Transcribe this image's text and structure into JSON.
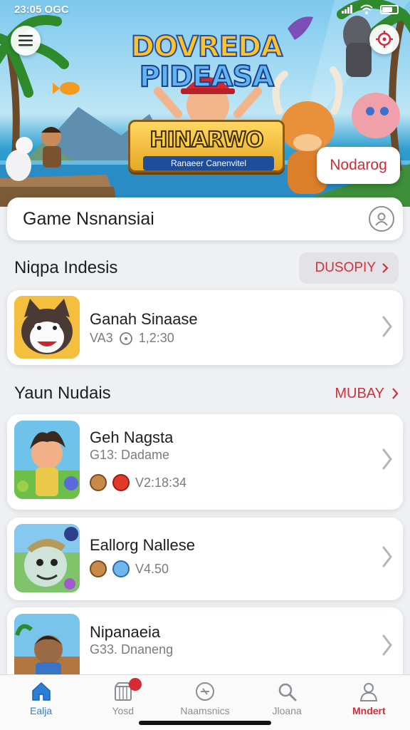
{
  "status_bar": {
    "time": "23:05 OGC"
  },
  "hero": {
    "title_line1": "DOVREDA",
    "title_line2": "PIDEASA",
    "banner_title": "HINARWO",
    "banner_subtitle": "Ranaeer Canenvitel",
    "tag_button": "Nodarog",
    "colors": {
      "accent": "#d42b35",
      "title_yellow": "#ffc328",
      "title_blue": "#5fb4f2"
    }
  },
  "search": {
    "label": "Game Nsnansiai",
    "icon": "profile-circle-icon"
  },
  "section1": {
    "title": "Niqpa Indesis",
    "action": "DUSOPIY"
  },
  "section2": {
    "title": "Yaun Nudais",
    "action": "MUBAY"
  },
  "games": [
    {
      "name": "Ganah Sinaase",
      "meta_prefix": "VA3",
      "meta_value": "1,2:30"
    },
    {
      "name": "Geh Nagsta",
      "sub": "G13: Dadame",
      "meta_value": "V2:18:34"
    },
    {
      "name": "Eallorg Nallese",
      "meta_value": "V4.50"
    },
    {
      "name": "Nipanaeia",
      "sub": "G33. Dnaneng"
    }
  ],
  "bottom_nav": {
    "items": [
      {
        "label": "Ealja",
        "icon": "home-icon"
      },
      {
        "label": "Yosd",
        "icon": "store-icon",
        "badge": ""
      },
      {
        "label": "Naamsnics",
        "icon": "game-icon"
      },
      {
        "label": "Jloana",
        "icon": "search-icon"
      },
      {
        "label": "Mndert",
        "icon": "profile-icon"
      }
    ]
  }
}
